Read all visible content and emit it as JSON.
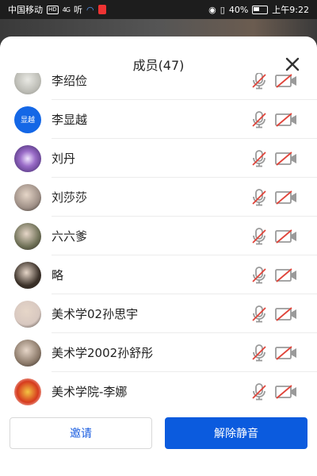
{
  "status_bar": {
    "carrier": "中国移动",
    "hd_badge": "HD",
    "signal": "4G",
    "listen_icon_text": "听",
    "battery": "40%",
    "time": "上午9:22"
  },
  "sheet": {
    "title": "成员(47)"
  },
  "members": [
    {
      "name": "李绍俭",
      "avatar_text": "",
      "avatar_color": "#c9c9c4",
      "avatar_icon": "sketch-avatar-icon"
    },
    {
      "name": "李显越",
      "avatar_text": "显越",
      "avatar_color": "#1467e6",
      "avatar_icon": "initials-avatar"
    },
    {
      "name": "刘丹",
      "avatar_text": "",
      "avatar_color": "#6a4b9a",
      "avatar_icon": "purple-avatar-icon"
    },
    {
      "name": "刘莎莎",
      "avatar_text": "",
      "avatar_color": "#9e8f86",
      "avatar_icon": "photo-avatar-icon"
    },
    {
      "name": "六六爹",
      "avatar_text": "",
      "avatar_color": "#6d6f55",
      "avatar_icon": "photo-avatar-icon"
    },
    {
      "name": "略",
      "avatar_text": "",
      "avatar_color": "#3a3028",
      "avatar_icon": "photo-avatar-icon"
    },
    {
      "name": "美术学02孙思宇",
      "avatar_text": "",
      "avatar_color": "#d8c8c0",
      "avatar_icon": "photo-avatar-icon"
    },
    {
      "name": "美术学2002孙舒彤",
      "avatar_text": "",
      "avatar_color": "#8c7a6a",
      "avatar_icon": "photo-avatar-icon"
    },
    {
      "name": "美术学院-李娜",
      "avatar_text": "",
      "avatar_color": "#d63a1e",
      "avatar_icon": "fortune-avatar-icon"
    }
  ],
  "footer": {
    "invite_label": "邀请",
    "unmute_all_label": "解除静音"
  },
  "colors": {
    "accent": "#0b5bde",
    "muted_icon": "#9a9a9a",
    "strike": "#e0443a"
  }
}
